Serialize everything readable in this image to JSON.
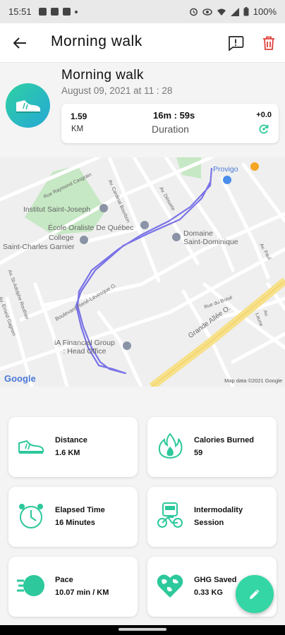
{
  "status_bar": {
    "time": "15:51",
    "battery": "100%"
  },
  "app_bar": {
    "title": "Morning walk"
  },
  "summary": {
    "title": "Morning walk",
    "date": "August 09, 2021 at 11 : 28",
    "distance_value": "1.59",
    "distance_unit": "KM",
    "duration_value": "16m : 59s",
    "duration_label": "Duration",
    "delta": "+0.0"
  },
  "map": {
    "labels": {
      "provigo": "Provigo",
      "institut": "Institut Saint-Joseph",
      "ecole": "École Oraliste De Québec",
      "college": "College",
      "charles": "Saint-Charles Garnier",
      "domaine": "Domaine\nSaint-Dominique",
      "ia": "iA Financial Group\n: Head Office",
      "grande": "Grande Allée O.",
      "blvd": "Boulevard René-Lévesque O.",
      "rue_raymond": "Rue Raymond Casgrain",
      "rue_boisé": "Rue du Boisé",
      "av_cardinal": "Av. Cardinal Bourbon",
      "av_desjardins": "Av. Désuete",
      "av_adolphe": "Av. St-Adolphe Routhier",
      "av_ernest": "Av. Ernest Gagnon",
      "av_laune": "Av. Laune",
      "av_pal": "Av. Paul"
    },
    "google": "Google",
    "attribution": "Map data ©2021 Google"
  },
  "stats": [
    {
      "label": "Distance",
      "value": "1.6 KM",
      "icon": "shoe-icon"
    },
    {
      "label": "Calories Burned",
      "value": "59",
      "icon": "flame-icon"
    },
    {
      "label": "Elapsed Time",
      "value": "16 Minutes",
      "icon": "clock-icon"
    },
    {
      "label": "Intermodality",
      "value": "Session",
      "icon": "bike-bus-icon"
    },
    {
      "label": "Pace",
      "value": "10.07 min / KM",
      "icon": "pace-icon"
    },
    {
      "label": "GHG Saved",
      "value": "0.33 KG",
      "icon": "globe-heart-icon"
    }
  ],
  "colors": {
    "accent": "#33d6a4",
    "route": "#7a73e6",
    "delete": "#e0403a",
    "park": "#c6e8c4"
  }
}
